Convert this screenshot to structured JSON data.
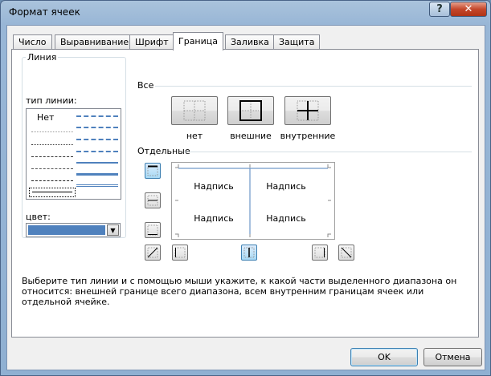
{
  "window": {
    "title": "Формат ячеек",
    "help_label": "?",
    "close_label": "✕"
  },
  "tabs": [
    {
      "label": "Число",
      "active": false
    },
    {
      "label": "Выравнивание",
      "active": false
    },
    {
      "label": "Шрифт",
      "active": false
    },
    {
      "label": "Граница",
      "active": true
    },
    {
      "label": "Заливка",
      "active": false
    },
    {
      "label": "Защита",
      "active": false
    }
  ],
  "line_group": {
    "caption": "Линия",
    "type_label": "тип линии:",
    "none_label": "Нет",
    "color_label": "цвет:",
    "color_value": "#4f81bd"
  },
  "presets": {
    "caption": "Все",
    "none_label": "нет",
    "outline_label": "внешние",
    "inside_label": "внутренние"
  },
  "border_group": {
    "caption": "Отдельные",
    "preview_text": [
      "Надпись",
      "Надпись",
      "Надпись",
      "Надпись"
    ],
    "line_color": "#4f81bd"
  },
  "hint": "Выберите тип линии и с помощью мыши укажите, к какой части выделенного диапазона он относится: внешней границе всего диапазона, всем внутренним границам ячеек или отдельной ячейке.",
  "buttons": {
    "ok": "OK",
    "cancel": "Отмена"
  }
}
